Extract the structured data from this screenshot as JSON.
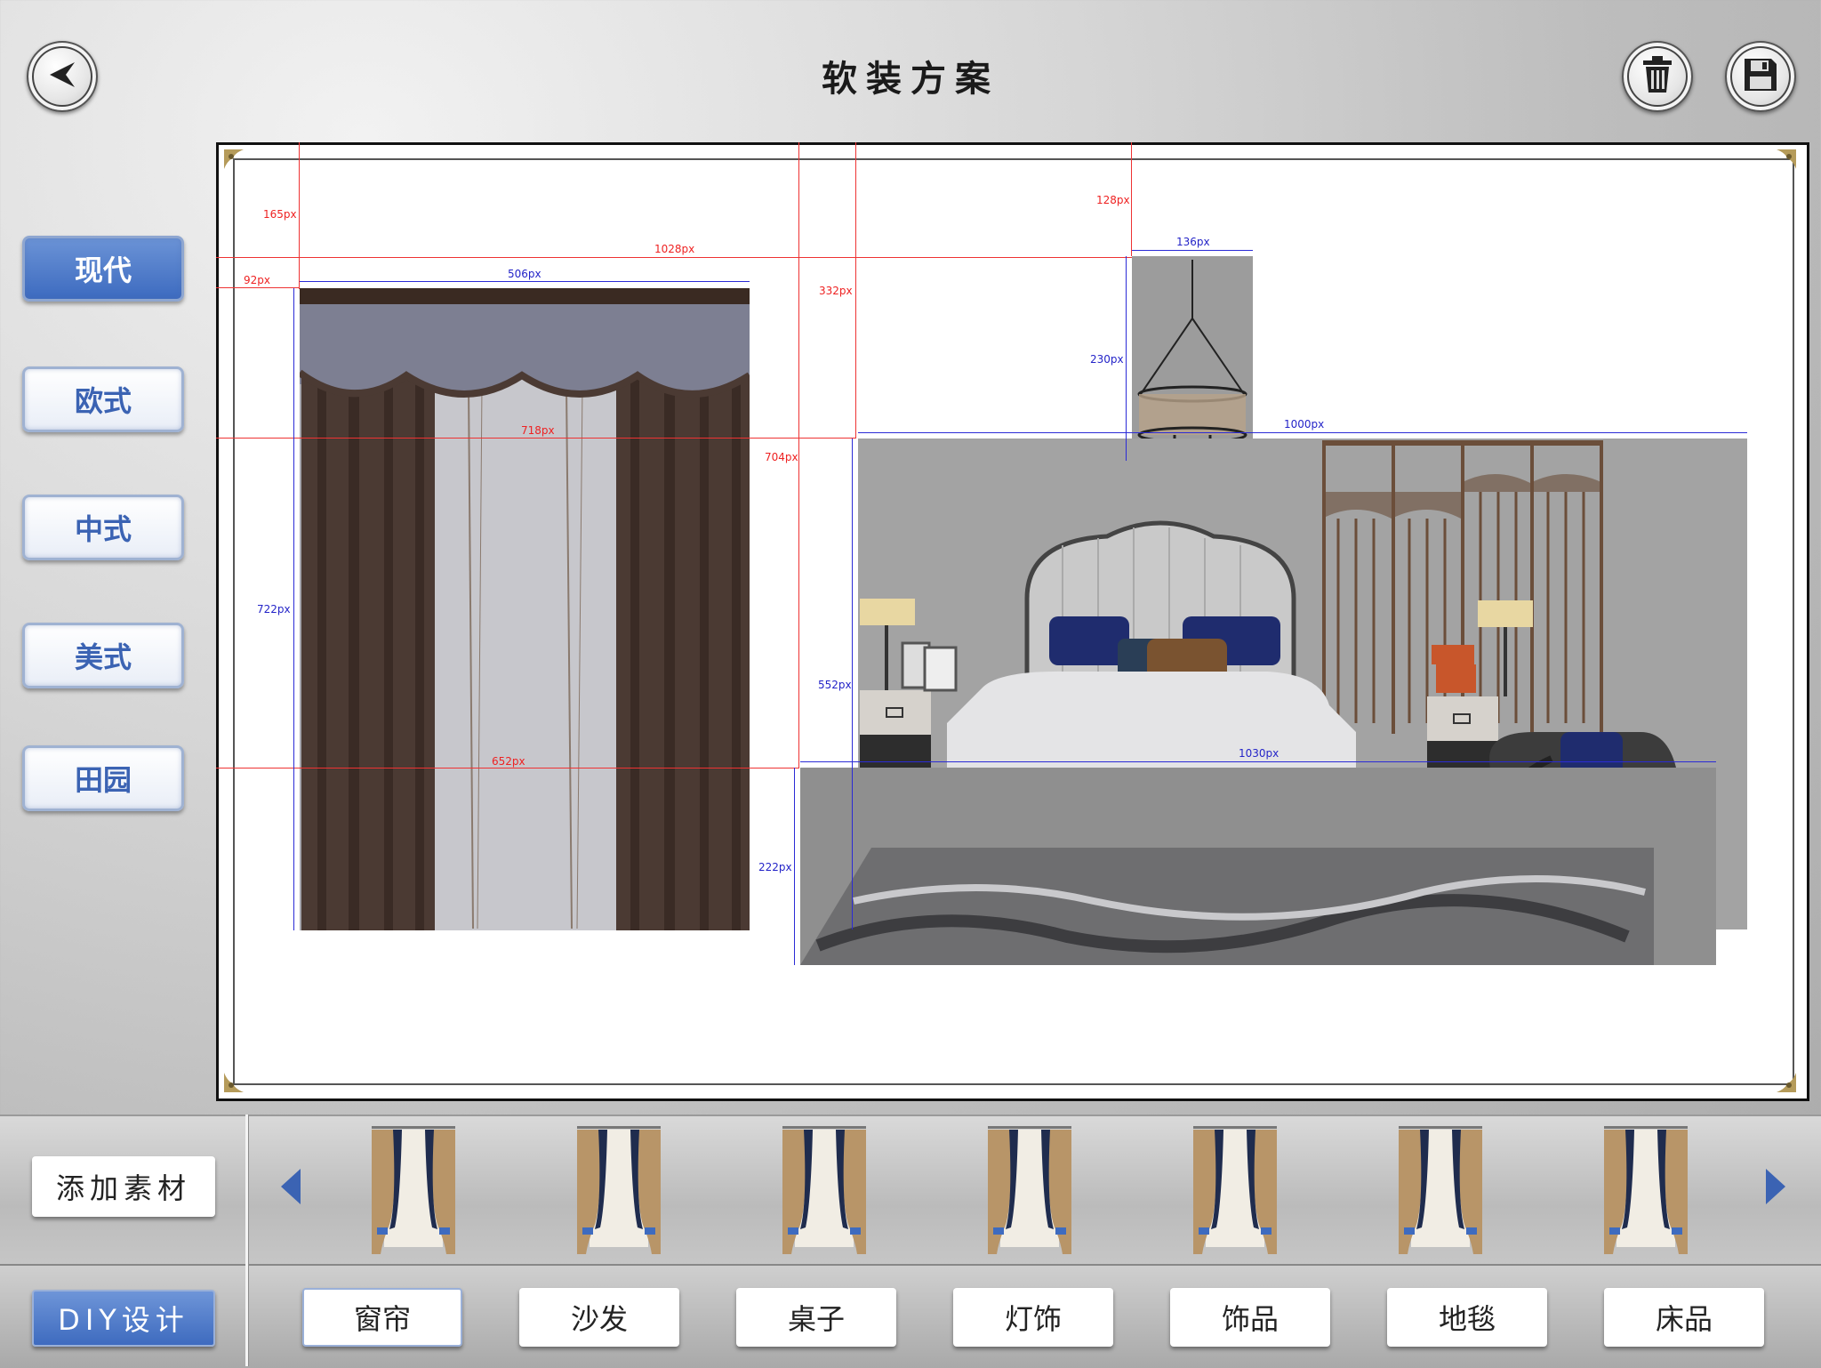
{
  "header": {
    "title": "软装方案",
    "back_icon": "back-arrow-icon",
    "delete_icon": "trash-icon",
    "save_icon": "save-disk-icon"
  },
  "styles": [
    {
      "label": "现代",
      "active": true
    },
    {
      "label": "欧式",
      "active": false
    },
    {
      "label": "中式",
      "active": false
    },
    {
      "label": "美式",
      "active": false
    },
    {
      "label": "田园",
      "active": false
    }
  ],
  "measurements": {
    "m165": "165px",
    "m1028": "1028px",
    "m92": "92px",
    "m506": "506px",
    "m332": "332px",
    "m128": "128px",
    "m136": "136px",
    "m230": "230px",
    "m718": "718px",
    "m704": "704px",
    "m1000": "1000px",
    "m722": "722px",
    "m552": "552px",
    "m652": "652px",
    "m1030": "1030px",
    "m222": "222px"
  },
  "materials": {
    "add_label": "添加素材",
    "diy_label": "DIY设计",
    "prev_icon": "arrow-left-icon",
    "next_icon": "arrow-right-icon",
    "thumb_count_shown": 7
  },
  "categories": [
    {
      "label": "窗帘",
      "active": true
    },
    {
      "label": "沙发",
      "active": false
    },
    {
      "label": "桌子",
      "active": false
    },
    {
      "label": "灯饰",
      "active": false
    },
    {
      "label": "饰品",
      "active": false
    },
    {
      "label": "地毯",
      "active": false
    },
    {
      "label": "床品",
      "active": false
    }
  ],
  "colors": {
    "accent_blue": "#3d6bc0",
    "measure_red": "#e22222",
    "measure_blue": "#2424c8"
  }
}
